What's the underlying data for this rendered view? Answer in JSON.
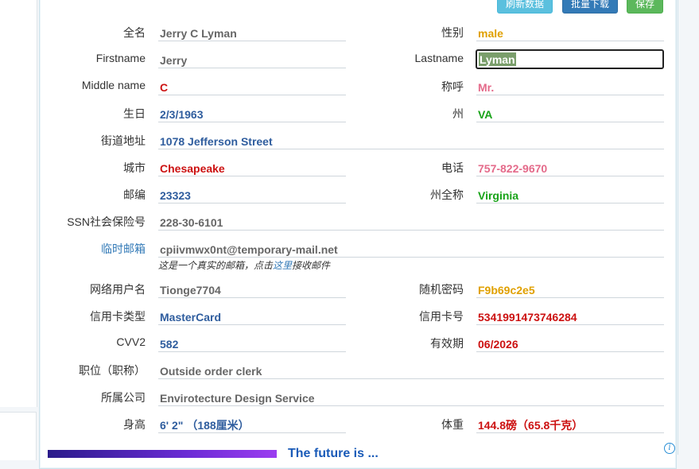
{
  "toolbar": {
    "refresh_label": "刷新数据",
    "download_label": "批量下载",
    "save_label": "保存"
  },
  "fields": {
    "fullname": {
      "label": "全名",
      "value": "Jerry C Lyman"
    },
    "gender": {
      "label": "性别",
      "value": "male"
    },
    "firstname": {
      "label": "Firstname",
      "value": "Jerry"
    },
    "lastname": {
      "label": "Lastname",
      "value": "Lyman"
    },
    "middlename": {
      "label": "Middle name",
      "value": "C"
    },
    "title": {
      "label": "称呼",
      "value": "Mr."
    },
    "birthday": {
      "label": "生日",
      "value": "2/3/1963"
    },
    "state": {
      "label": "州",
      "value": "VA"
    },
    "street": {
      "label": "街道地址",
      "value": "1078 Jefferson Street"
    },
    "city": {
      "label": "城市",
      "value": "Chesapeake"
    },
    "phone": {
      "label": "电话",
      "value": "757-822-9670"
    },
    "zip": {
      "label": "邮编",
      "value": "23323"
    },
    "state_full": {
      "label": "州全称",
      "value": "Virginia"
    },
    "ssn": {
      "label": "SSN社会保险号",
      "value": "228-30-6101"
    },
    "temp_email": {
      "label": "临时邮箱",
      "value": "cpiivmwx0nt@temporary-mail.net"
    },
    "email_note": {
      "prefix": "这是一个真实的邮箱，点击",
      "link": "这里",
      "suffix": "接收邮件"
    },
    "username": {
      "label": "网络用户名",
      "value": "Tionge7704"
    },
    "password": {
      "label": "随机密码",
      "value": "F9b69c2e5"
    },
    "card_type": {
      "label": "信用卡类型",
      "value": "MasterCard"
    },
    "card_number": {
      "label": "信用卡号",
      "value": "5341991473746284"
    },
    "cvv2": {
      "label": "CVV2",
      "value": "582"
    },
    "expiry": {
      "label": "有效期",
      "value": "06/2026"
    },
    "occupation": {
      "label": "职位（职称）",
      "value": "Outside order clerk"
    },
    "company": {
      "label": "所属公司",
      "value": "Envirotecture Design Service"
    },
    "height": {
      "label": "身高",
      "value": "6' 2\" （188厘米）"
    },
    "weight": {
      "label": "体重",
      "value": "144.8磅（65.8千克）"
    }
  },
  "ad": {
    "text": "The future is ..."
  },
  "icons": {
    "info": "info-icon"
  }
}
